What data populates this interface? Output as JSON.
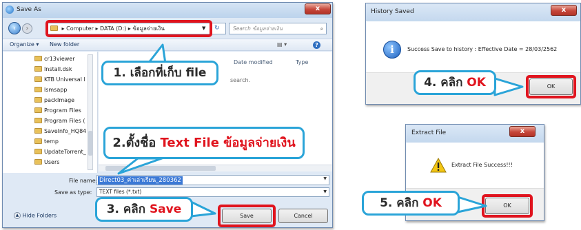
{
  "save_as": {
    "title": "Save As",
    "breadcrumb": [
      "Computer",
      "DATA (D:)",
      "ข้อมูลจ่ายเงิน"
    ],
    "search_placeholder": "Search ข้อมูลจ่ายเงิน",
    "organize": "Organize ▾",
    "new_folder": "New folder",
    "col_date": "Date modified",
    "col_type": "Type",
    "empty_text": "search.",
    "folders": [
      "cr13viewer",
      "Install.dsk",
      "KTB Universal I",
      "lsmsapp",
      "packImage",
      "Program Files",
      "Program Files (",
      "SaveInfo_HQ84",
      "temp",
      "UpdateTorrent_",
      "Users"
    ],
    "file_name_label": "File name:",
    "file_name_value": "Direct03_ค่าเล่าเรียน_280362",
    "save_type_label": "Save as type:",
    "save_type_value": "TEXT files (*.txt)",
    "hide_folders": "Hide Folders",
    "save_label": "Save",
    "cancel_label": "Cancel"
  },
  "history": {
    "title": "History Saved",
    "message": "Success Save to history : Effective Date = 28/03/2562",
    "ok_label": "OK"
  },
  "extract": {
    "title": "Extract File",
    "message": "Extract File Success!!!",
    "ok_label": "OK"
  },
  "callouts": {
    "c1": "1. เลือกที่เก็บ file",
    "c2_prefix": "2.ตั้งชื่อ ",
    "c2_red": "Text File ข้อมูลจ่ายเงิน",
    "c3_prefix": "3. คลิก ",
    "c3_red": "Save",
    "c4_prefix": "4. คลิก ",
    "c4_red": "OK",
    "c5_prefix": "5. คลิก ",
    "c5_red": "OK"
  },
  "colors": {
    "accent": "#2aa4d8",
    "highlight": "#e0141e"
  }
}
